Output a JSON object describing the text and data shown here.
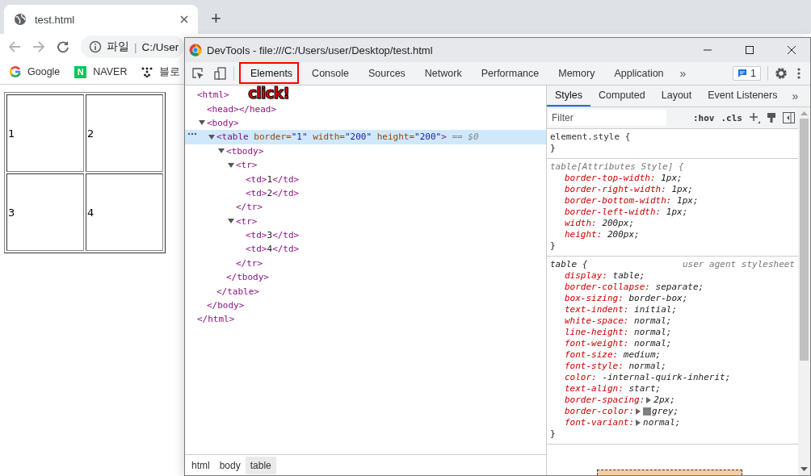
{
  "browser": {
    "tab_title": "test.html",
    "new_tab": "+",
    "address": {
      "scheme": "파일",
      "separator": "|",
      "url": "C:/User"
    },
    "bookmarks": [
      {
        "kind": "google",
        "label": "Google"
      },
      {
        "kind": "naver",
        "icon_text": "N",
        "label": "NAVER"
      },
      {
        "kind": "blog",
        "label": "블로"
      }
    ]
  },
  "page": {
    "table": [
      [
        "1",
        "2"
      ],
      [
        "3",
        "4"
      ]
    ]
  },
  "devtools": {
    "title": "DevTools - file:///C:/Users/user/Desktop/test.html",
    "tabs": [
      {
        "label": "Elements",
        "selected": true
      },
      {
        "label": "Console",
        "selected": false
      },
      {
        "label": "Sources",
        "selected": false
      },
      {
        "label": "Network",
        "selected": false
      },
      {
        "label": "Performance",
        "selected": false
      },
      {
        "label": "Memory",
        "selected": false
      },
      {
        "label": "Application",
        "selected": false
      }
    ],
    "more_tabs": "»",
    "issues_count": "1",
    "annotation": {
      "text": "click!"
    },
    "tree": [
      {
        "tokens": [
          {
            "kind": "tag",
            "text": "<html>"
          }
        ],
        "close": [
          {
            "kind": "tag",
            "text": "</html>"
          }
        ],
        "children": [
          {
            "tokens": [
              {
                "kind": "tag",
                "text": "<head></head>"
              }
            ]
          },
          {
            "expanded": true,
            "tokens": [
              {
                "kind": "tag",
                "text": "<body>"
              }
            ],
            "close": [
              {
                "kind": "tag",
                "text": "</body>"
              }
            ],
            "children": [
              {
                "expanded": true,
                "selected": true,
                "tokens": [
                  {
                    "kind": "tag",
                    "text": "<table"
                  },
                  {
                    "kind": "attr",
                    "text": " border="
                  },
                  {
                    "kind": "val",
                    "text": "\"1\""
                  },
                  {
                    "kind": "attr",
                    "text": " width="
                  },
                  {
                    "kind": "val",
                    "text": "\"200\""
                  },
                  {
                    "kind": "attr",
                    "text": " height="
                  },
                  {
                    "kind": "val",
                    "text": "\"200\""
                  },
                  {
                    "kind": "tag",
                    "text": ">"
                  },
                  {
                    "kind": "hint",
                    "text": " == $0"
                  }
                ],
                "close": [
                  {
                    "kind": "tag",
                    "text": "</table>"
                  }
                ],
                "children": [
                  {
                    "expanded": true,
                    "selected": false,
                    "tokens": [
                      {
                        "kind": "tag",
                        "text": "<tbody>"
                      }
                    ],
                    "close": [
                      {
                        "kind": "tag",
                        "text": "</tbody>"
                      }
                    ],
                    "children": [
                      {
                        "expanded": true,
                        "selected": false,
                        "tokens": [
                          {
                            "kind": "tag",
                            "text": "<tr>"
                          }
                        ],
                        "close": [
                          {
                            "kind": "tag",
                            "text": "</tr>"
                          }
                        ],
                        "children": [
                          {
                            "tokens": [
                              {
                                "kind": "tag",
                                "text": "<td>"
                              },
                              {
                                "kind": "text",
                                "text": "1"
                              },
                              {
                                "kind": "tag",
                                "text": "</td>"
                              }
                            ]
                          },
                          {
                            "tokens": [
                              {
                                "kind": "tag",
                                "text": "<td>"
                              },
                              {
                                "kind": "text",
                                "text": "2"
                              },
                              {
                                "kind": "tag",
                                "text": "</td>"
                              }
                            ]
                          }
                        ]
                      },
                      {
                        "expanded": true,
                        "selected": false,
                        "tokens": [
                          {
                            "kind": "tag",
                            "text": "<tr>"
                          }
                        ],
                        "close": [
                          {
                            "kind": "tag",
                            "text": "</tr>"
                          }
                        ],
                        "children": [
                          {
                            "tokens": [
                              {
                                "kind": "tag",
                                "text": "<td>"
                              },
                              {
                                "kind": "text",
                                "text": "3"
                              },
                              {
                                "kind": "tag",
                                "text": "</td>"
                              }
                            ]
                          },
                          {
                            "tokens": [
                              {
                                "kind": "tag",
                                "text": "<td>"
                              },
                              {
                                "kind": "text",
                                "text": "4"
                              },
                              {
                                "kind": "tag",
                                "text": "</td>"
                              }
                            ]
                          }
                        ]
                      }
                    ]
                  }
                ]
              }
            ]
          }
        ]
      }
    ],
    "breadcrumbs": [
      {
        "label": "html",
        "selected": false
      },
      {
        "label": "body",
        "selected": false
      },
      {
        "label": "table",
        "selected": true
      }
    ],
    "side_tabs": [
      {
        "label": "Styles",
        "selected": true
      },
      {
        "label": "Computed",
        "selected": false
      },
      {
        "label": "Layout",
        "selected": false
      },
      {
        "label": "Event Listeners",
        "selected": false
      }
    ],
    "side_more": "»",
    "filter": {
      "placeholder": "Filter"
    },
    "hov": ":hov",
    "cls": ".cls",
    "rules": [
      {
        "kind": "inline",
        "selector": "element.style {",
        "close": "}"
      },
      {
        "kind": "attributes",
        "selector": "table[Attributes Style] {",
        "close": "}",
        "props": [
          {
            "name": "border-top-width:",
            "value": "1px;"
          },
          {
            "name": "border-right-width:",
            "value": "1px;"
          },
          {
            "name": "border-bottom-width:",
            "value": "1px;"
          },
          {
            "name": "border-left-width:",
            "value": "1px;"
          },
          {
            "name": "width:",
            "value": "200px;"
          },
          {
            "name": "height:",
            "value": "200px;"
          }
        ]
      },
      {
        "kind": "user-agent",
        "selector": "table {",
        "source": "user agent stylesheet",
        "close": "}",
        "props": [
          {
            "name": "display:",
            "value": "table;"
          },
          {
            "name": "border-collapse:",
            "value": "separate;"
          },
          {
            "name": "box-sizing:",
            "value": "border-box;"
          },
          {
            "name": "text-indent:",
            "value": "initial;"
          },
          {
            "name": "white-space:",
            "value": "normal;"
          },
          {
            "name": "line-height:",
            "value": "normal;"
          },
          {
            "name": "font-weight:",
            "value": "normal;"
          },
          {
            "name": "font-size:",
            "value": "medium;"
          },
          {
            "name": "font-style:",
            "value": "normal;"
          },
          {
            "name": "color:",
            "value": "-internal-quirk-inherit;"
          },
          {
            "name": "text-align:",
            "value": "start;"
          },
          {
            "name": "border-spacing:",
            "value": "2px;",
            "expandable": true
          },
          {
            "name": "border-color:",
            "value": "grey;",
            "expandable": true,
            "color": "#808080"
          },
          {
            "name": "font-variant:",
            "value": "normal;",
            "expandable": true
          }
        ]
      }
    ]
  }
}
